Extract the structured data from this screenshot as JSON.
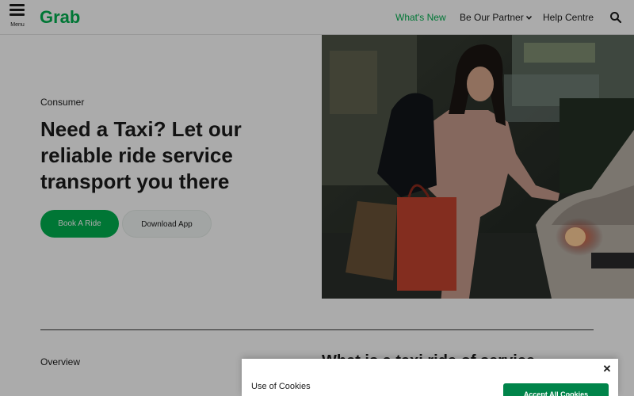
{
  "header": {
    "menu_label": "Menu",
    "logo_text": "Grab",
    "nav": [
      {
        "label": "What's New",
        "active": true
      },
      {
        "label": "Be Our Partner",
        "has_dropdown": true
      },
      {
        "label": "Help Centre"
      }
    ],
    "search_icon": "search-icon"
  },
  "hero": {
    "eyebrow": "Consumer",
    "title": "Need a Taxi? Let our reliable ride service transport you there",
    "primary_button": "Book A Ride",
    "secondary_button": "Download App",
    "image": "woman-with-shopping-bags-opening-car-door"
  },
  "overview": {
    "label": "Overview",
    "heading": "What is a taxi ride of service"
  },
  "cookie_banner": {
    "title": "Use of Cookies",
    "accept_button": "Accept All Cookies",
    "close_icon": "close-icon"
  },
  "colors": {
    "brand_green": "#00b14f",
    "accept_green": "#00844a",
    "overlay": "rgba(0,0,0,0.33)"
  }
}
